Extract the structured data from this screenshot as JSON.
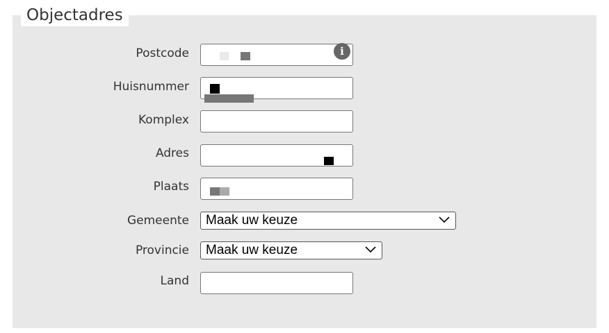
{
  "section": {
    "title": "Objectadres"
  },
  "fields": {
    "postcode": {
      "label": "Postcode",
      "value": ""
    },
    "huisnummer": {
      "label": "Huisnummer",
      "value": ""
    },
    "komplex": {
      "label": "Komplex",
      "value": ""
    },
    "adres": {
      "label": "Adres",
      "value": ""
    },
    "plaats": {
      "label": "Plaats",
      "value": ""
    },
    "gemeente": {
      "label": "Gemeente",
      "selected": "Maak uw keuze"
    },
    "provincie": {
      "label": "Provincie",
      "selected": "Maak uw keuze"
    },
    "land": {
      "label": "Land",
      "value": ""
    }
  },
  "icons": {
    "postcode_help": "info-icon",
    "dropdown": "chevron-down-icon"
  },
  "colors": {
    "panel": "#e8e8e8",
    "text": "#333333"
  }
}
